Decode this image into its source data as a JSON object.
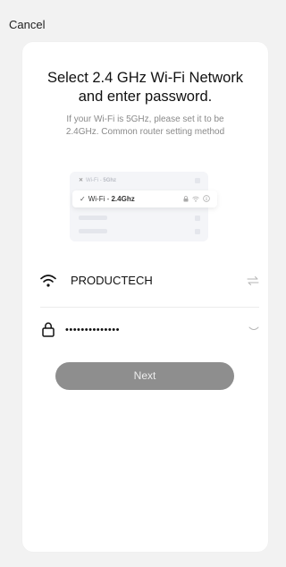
{
  "header": {
    "cancel_label": "Cancel"
  },
  "instructions": {
    "title_line1": "Select 2.4 GHz Wi-Fi Network",
    "title_line2": "and enter password.",
    "subtitle_line1": "If your Wi-Fi is 5GHz, please set it to be",
    "subtitle_line2": "2.4GHz. Common router setting method"
  },
  "illustration": {
    "row1_prefix": "Wi-Fi - ",
    "row1_band": "5Ghz",
    "row2_prefix": "Wi-Fi - ",
    "row2_band": "2.4Ghz"
  },
  "network": {
    "ssid": "PRODUCTECH",
    "icon": "wifi-icon",
    "switch_icon": "switch-network-icon"
  },
  "password": {
    "value": "••••••••••••••",
    "lock_icon": "lock-icon",
    "toggle_icon": "eye-closed-icon"
  },
  "actions": {
    "next_label": "Next"
  },
  "colors": {
    "background": "#f2f2f2",
    "card": "#ffffff",
    "button": "#8e8e8e",
    "muted_text": "#8a8a8a"
  }
}
